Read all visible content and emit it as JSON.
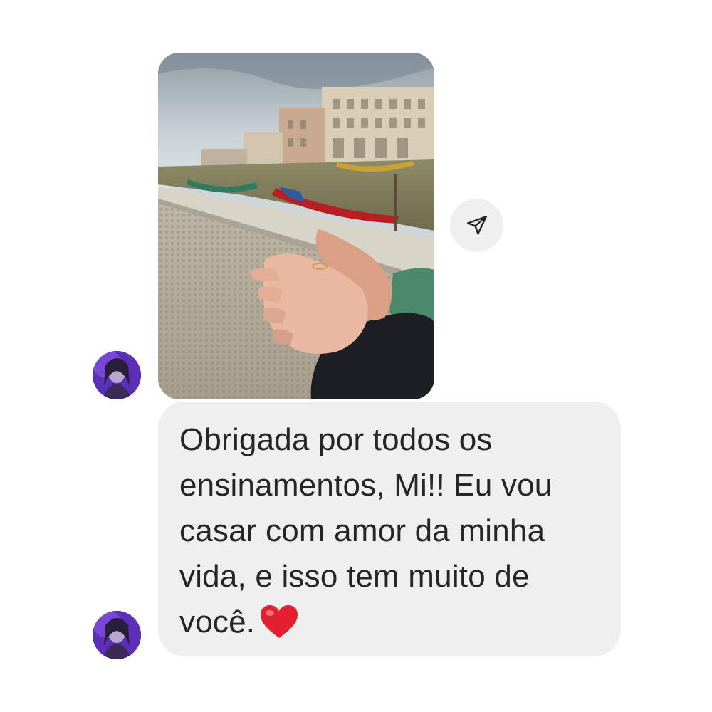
{
  "conversation": {
    "shared_post": {
      "image_description_icon": "photo-hands-canal"
    },
    "share_button": {
      "icon": "paper-plane-icon"
    },
    "message": {
      "lines": [
        "Obrigada por todos os",
        "ensinamentos, Mi!! Eu vou",
        "casar com amor da minha",
        "vida, e isso tem muito de",
        "você."
      ],
      "emoji": "red-heart-icon"
    },
    "avatar": {
      "accent": "#6b3fd0"
    }
  },
  "colors": {
    "bubble_bg": "#efefef",
    "text": "#262626",
    "heart": "#e5202e"
  }
}
